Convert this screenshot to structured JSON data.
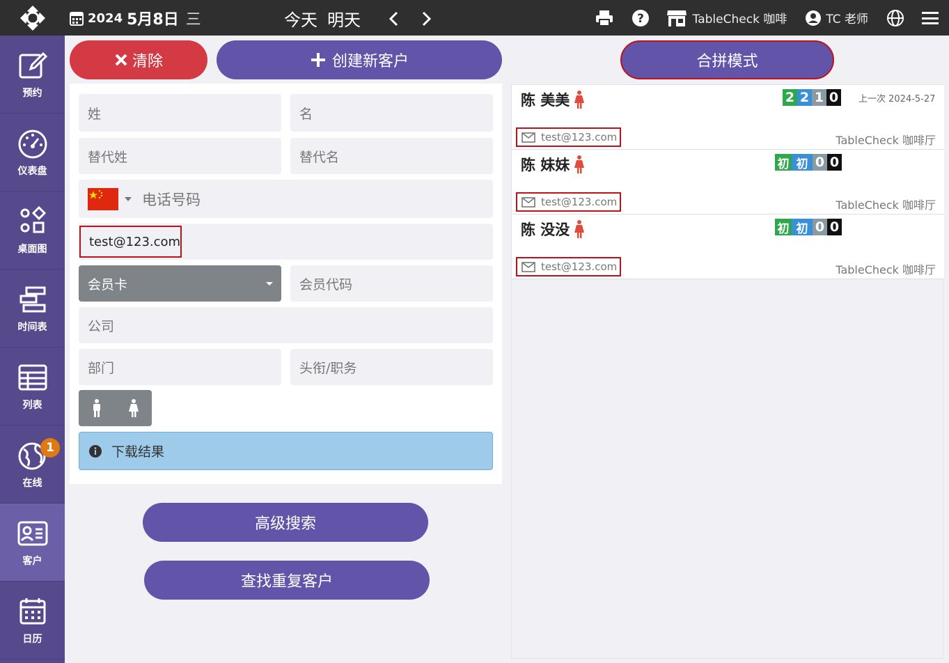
{
  "topbar": {
    "year": "2024",
    "month_day": "5月8日",
    "weekday": "三",
    "today": "今天",
    "tomorrow": "明天",
    "store": "TableCheck 咖啡",
    "user": "TC 老师"
  },
  "sidebar": {
    "items": [
      {
        "label": "预约",
        "icon": "edit-icon"
      },
      {
        "label": "仪表盘",
        "icon": "dashboard-icon"
      },
      {
        "label": "桌面图",
        "icon": "floorplan-icon"
      },
      {
        "label": "时间表",
        "icon": "timetable-icon"
      },
      {
        "label": "列表",
        "icon": "table-icon"
      },
      {
        "label": "在线",
        "icon": "globe-icon",
        "badge": "1"
      },
      {
        "label": "客户",
        "icon": "customer-card-icon",
        "active": true
      },
      {
        "label": "日历",
        "icon": "calendar-icon"
      }
    ]
  },
  "actions": {
    "clear": "清除",
    "create": "创建新客户",
    "merge": "合拼模式",
    "advanced_search": "高级搜索",
    "find_duplicates": "查找重复客户"
  },
  "form": {
    "last_name_placeholder": "姓",
    "first_name_placeholder": "名",
    "alt_last_placeholder": "替代姓",
    "alt_first_placeholder": "替代名",
    "phone_placeholder": "电话号码",
    "email_value": "test@123.com",
    "membership_select": "会员卡",
    "member_code_placeholder": "会员代码",
    "company_placeholder": "公司",
    "department_placeholder": "部门",
    "title_placeholder": "头衔/职务",
    "info_message": "下载结果"
  },
  "results": [
    {
      "name": "陈 美美",
      "stats": [
        "2",
        "2",
        "1",
        "0"
      ],
      "stat_colors": [
        "#2ea84a",
        "#3a8fd9",
        "#8a9aa3",
        "#111111"
      ],
      "last_visit": "上一次 2024-5-27",
      "email": "test@123.com",
      "venue": "TableCheck 咖啡厅"
    },
    {
      "name": "陈 妹妹",
      "stats": [
        "初",
        "初",
        "0",
        "0"
      ],
      "stat_colors": [
        "#2ea84a",
        "#3a8fd9",
        "#8a9aa3",
        "#111111"
      ],
      "last_visit": "",
      "email": "test@123.com",
      "venue": "TableCheck 咖啡厅"
    },
    {
      "name": "陈 没没",
      "stats": [
        "初",
        "初",
        "0",
        "0"
      ],
      "stat_colors": [
        "#2ea84a",
        "#3a8fd9",
        "#8a9aa3",
        "#111111"
      ],
      "last_visit": "",
      "email": "test@123.com",
      "venue": "TableCheck 咖啡厅"
    }
  ],
  "colors": {
    "primary": "#6254a8",
    "sidebar": "#564a8c",
    "danger": "#d33a44",
    "highlight": "#c0101a",
    "female_icon": "#e04b3c"
  }
}
